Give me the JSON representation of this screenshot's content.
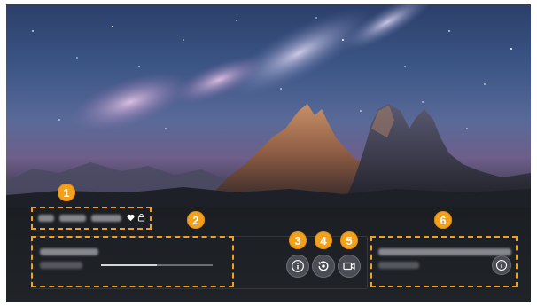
{
  "callouts": [
    {
      "number": "1"
    },
    {
      "number": "2"
    },
    {
      "number": "3"
    },
    {
      "number": "4"
    },
    {
      "number": "5"
    },
    {
      "number": "6"
    }
  ],
  "media_info": {
    "progress": 0.5
  },
  "icons": {
    "favorite": "heart-icon",
    "lock": "lock-icon",
    "info": "info-icon",
    "replay": "replay-icon",
    "record": "video-icon"
  },
  "colors": {
    "callout": "#f3a01d",
    "panel": "#1b1e22",
    "button": "#4a4d54"
  }
}
